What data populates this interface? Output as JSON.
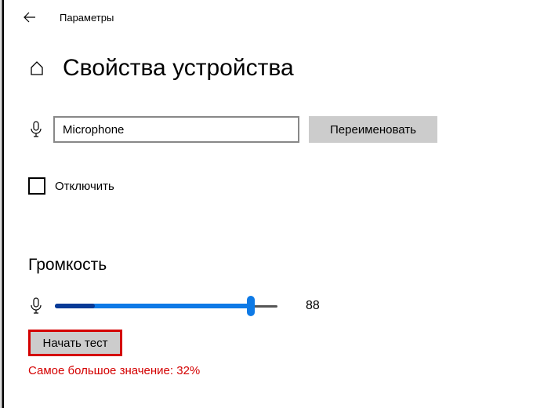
{
  "header": {
    "app_title": "Параметры"
  },
  "page": {
    "title": "Свойства устройства"
  },
  "device": {
    "name_value": "Microphone",
    "rename_label": "Переименовать",
    "disable_label": "Отключить",
    "disable_checked": false
  },
  "volume": {
    "section_title": "Громкость",
    "value": 88,
    "fill_percent": 88,
    "dark_fill_percent": 18
  },
  "test": {
    "start_label": "Начать тест",
    "max_value_label": "Самое большое значение: 32%"
  }
}
